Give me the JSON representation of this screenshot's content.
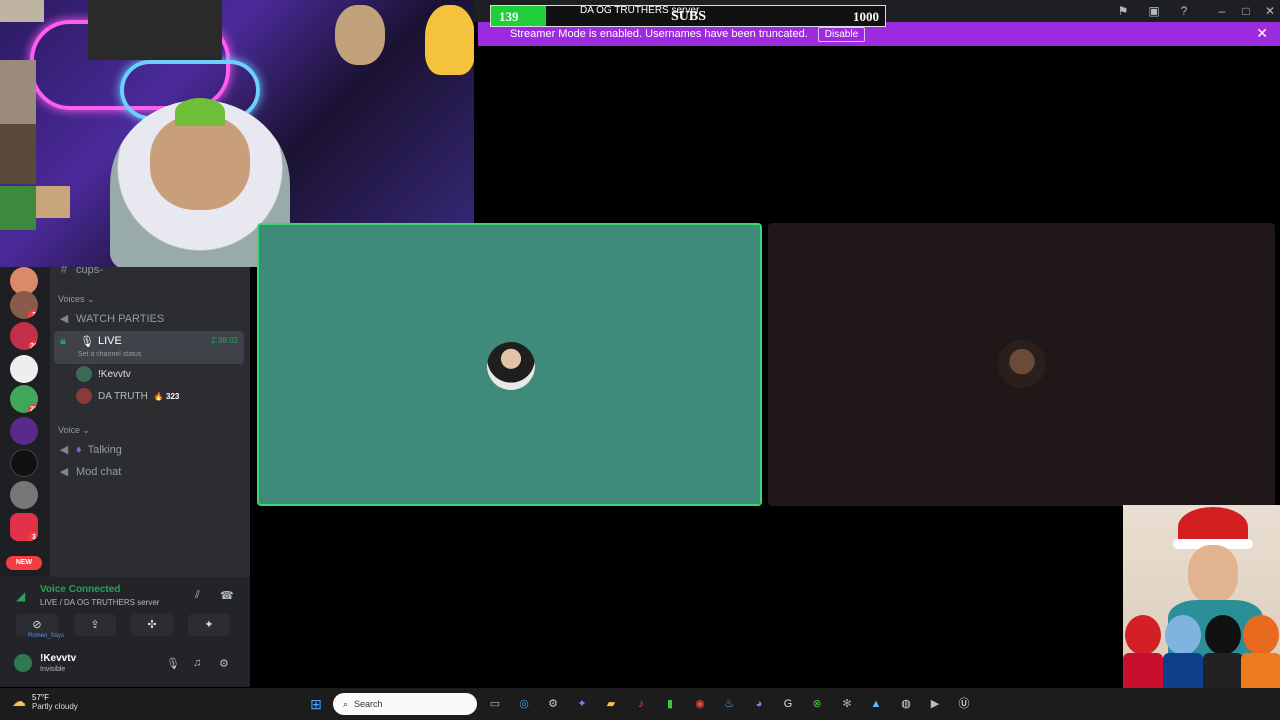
{
  "titlebar": {
    "icons": [
      "inbox-icon",
      "monitor-icon",
      "help-icon",
      "minimize-icon",
      "maximize-icon",
      "close-icon"
    ]
  },
  "subgoal": {
    "current": "139",
    "label": "SUBS",
    "goal": "1000",
    "progress_fraction": 0.139
  },
  "server_title": "DA OG TRUTHERS server",
  "banner": {
    "text": "Streamer Mode is enabled. Usernames have been truncated.",
    "disable_label": "Disable"
  },
  "channels": {
    "top_partial": "cups-",
    "voices_category": "Voices",
    "watch_parties": "WATCH PARTIES",
    "live": "LIVE",
    "live_timer": "2:38:02",
    "live_status": "Set a channel status",
    "users": [
      {
        "name": "!Kevvtv"
      },
      {
        "name": "DA TRUTH",
        "count": "323"
      }
    ],
    "voice_category": "Voice",
    "talking": "Talking",
    "mod_chat": "Mod chat"
  },
  "servers": [
    {
      "badge": ""
    },
    {
      "badge": "2"
    },
    {
      "badge": "36"
    },
    {
      "badge": ""
    },
    {
      "badge": "26"
    },
    {
      "badge": ""
    },
    {
      "badge": ""
    },
    {
      "badge": ""
    },
    {
      "badge": "3"
    }
  ],
  "new_label": "NEW",
  "voice_panel": {
    "status": "Voice Connected",
    "location": "LIVE / DA OG TRUTHERS server",
    "username": "!Kevvtv",
    "user_status": "Invisible",
    "overlay_user": "Romeo_Says"
  },
  "taskbar": {
    "temp": "57°F",
    "condition": "Partly cloudy",
    "search_placeholder": "Search"
  },
  "colors": {
    "accent_purple": "#9b2bdd",
    "voice_green": "#23a55a",
    "tile_teal": "#3d8b78",
    "tile_border": "#3ed670",
    "goal_green": "#1fcf3b"
  }
}
